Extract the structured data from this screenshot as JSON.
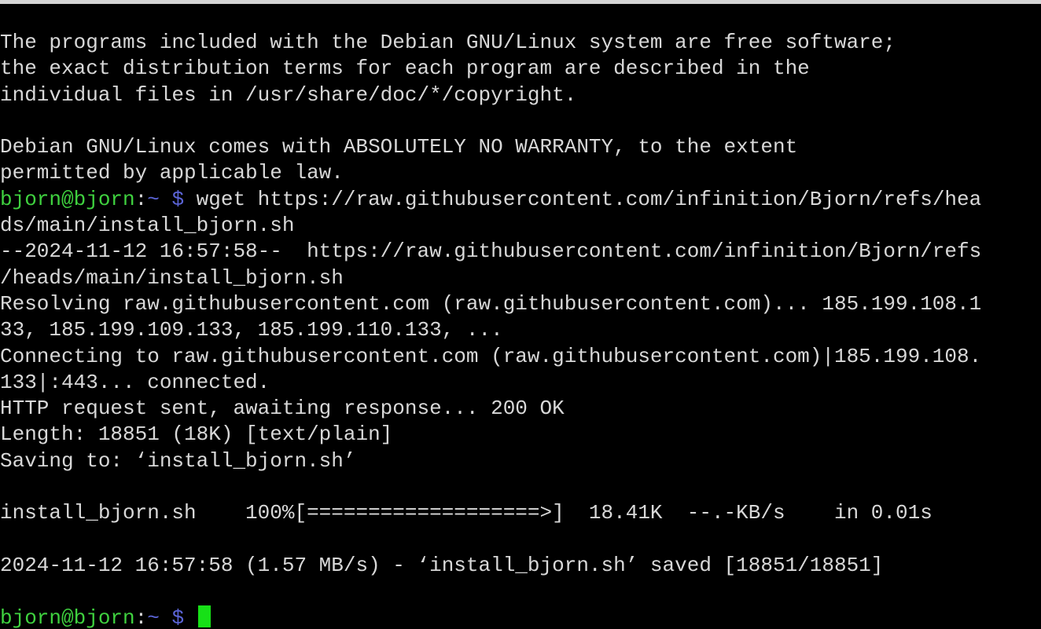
{
  "terminal": {
    "prompt": {
      "user_host": "bjorn@bjorn",
      "separator": ":",
      "path": "~",
      "symbol": " $ "
    },
    "motd": [
      "The programs included with the Debian GNU/Linux system are free software;",
      "the exact distribution terms for each program are described in the",
      "individual files in /usr/share/doc/*/copyright.",
      "",
      "Debian GNU/Linux comes with ABSOLUTELY NO WARRANTY, to the extent",
      "permitted by applicable law."
    ],
    "command": "wget https://raw.githubusercontent.com/infinition/Bjorn/refs/hea",
    "output": [
      "ds/main/install_bjorn.sh",
      "--2024-11-12 16:57:58--  https://raw.githubusercontent.com/infinition/Bjorn/refs",
      "/heads/main/install_bjorn.sh",
      "Resolving raw.githubusercontent.com (raw.githubusercontent.com)... 185.199.108.1",
      "33, 185.199.109.133, 185.199.110.133, ...",
      "Connecting to raw.githubusercontent.com (raw.githubusercontent.com)|185.199.108.",
      "133|:443... connected.",
      "HTTP request sent, awaiting response... 200 OK",
      "Length: 18851 (18K) [text/plain]",
      "Saving to: ‘install_bjorn.sh’",
      "",
      "install_bjorn.sh    100%[===================>]  18.41K  --.-KB/s    in 0.01s",
      "",
      "2024-11-12 16:57:58 (1.57 MB/s) - ‘install_bjorn.sh’ saved [18851/18851]",
      ""
    ],
    "colors": {
      "background": "#000000",
      "text": "#d8d8d8",
      "prompt_user": "#3fd13f",
      "prompt_path": "#5b64d6",
      "cursor": "#17e017"
    }
  }
}
